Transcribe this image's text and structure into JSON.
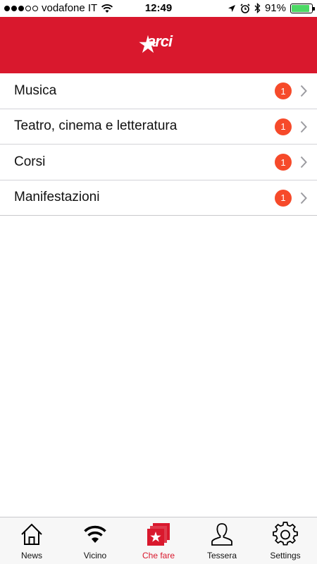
{
  "status_bar": {
    "carrier": "vodafone IT",
    "time": "12:49",
    "battery_percent": "91%",
    "battery_level": 0.91,
    "signal_bars_filled": 3,
    "signal_bars_total": 5
  },
  "header": {
    "logo_text": "arci",
    "brand_color": "#d9182d"
  },
  "categories": [
    {
      "label": "Musica",
      "badge": "1"
    },
    {
      "label": "Teatro, cinema e letteratura",
      "badge": "1"
    },
    {
      "label": "Corsi",
      "badge": "1"
    },
    {
      "label": "Manifestazioni",
      "badge": "1"
    }
  ],
  "tabbar": {
    "tabs": [
      {
        "label": "News",
        "icon": "house-icon",
        "active": false
      },
      {
        "label": "Vicino",
        "icon": "wifi-icon",
        "active": false
      },
      {
        "label": "Che fare",
        "icon": "star-stack-icon",
        "active": true
      },
      {
        "label": "Tessera",
        "icon": "person-icon",
        "active": false
      },
      {
        "label": "Settings",
        "icon": "gear-icon",
        "active": false
      }
    ]
  },
  "colors": {
    "accent": "#d9182d",
    "badge": "#f64a2a",
    "separator": "#d3d3d8"
  }
}
